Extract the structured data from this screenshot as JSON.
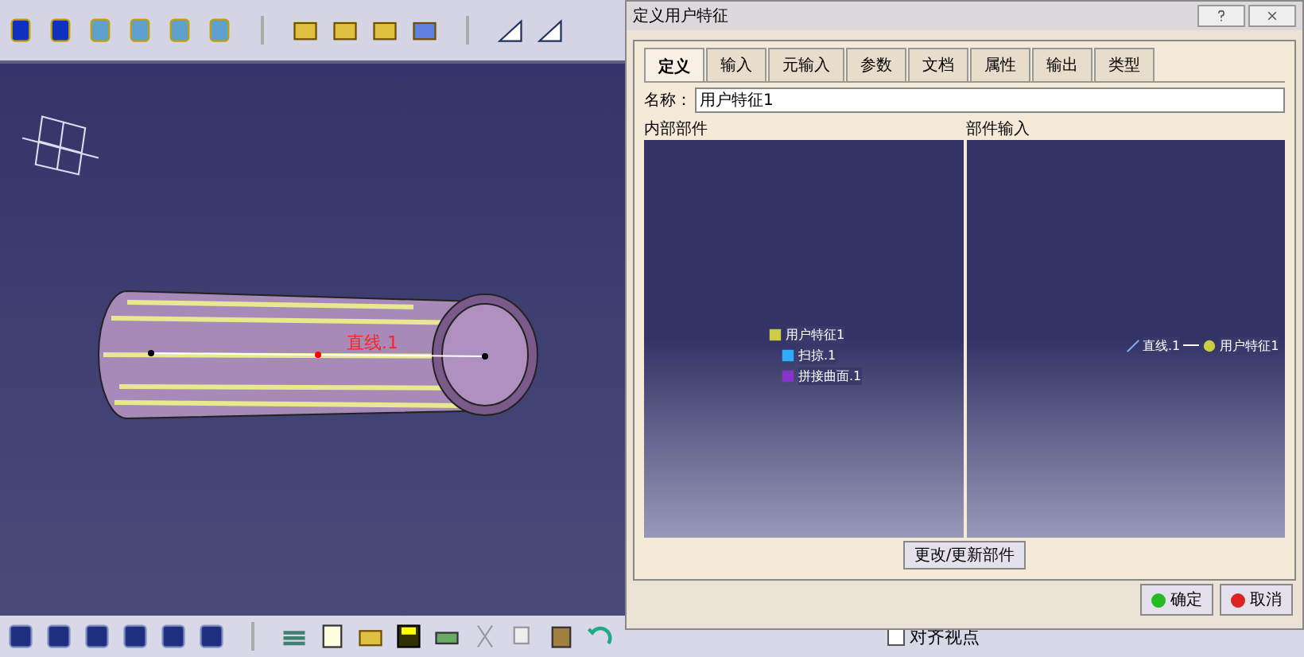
{
  "viewport": {
    "curve_label": "直线.1"
  },
  "dialog": {
    "title": "定义用户特征",
    "tabs": [
      {
        "label": "定义",
        "selected": true
      },
      {
        "label": "输入",
        "selected": false
      },
      {
        "label": "元输入",
        "selected": false
      },
      {
        "label": "参数",
        "selected": false
      },
      {
        "label": "文档",
        "selected": false
      },
      {
        "label": "属性",
        "selected": false
      },
      {
        "label": "输出",
        "selected": false
      },
      {
        "label": "类型",
        "selected": false
      }
    ],
    "name_label": "名称：",
    "name_value": "用户特征1",
    "internal_label": "内部部件",
    "inputs_label": "部件输入",
    "tree": [
      {
        "label": "用户特征1",
        "children": [
          {
            "label": "扫掠.1"
          },
          {
            "label": "拼接曲面.1"
          }
        ]
      }
    ],
    "inputs": [
      {
        "label": "直线.1",
        "target": "用户特征1"
      }
    ],
    "update_button": "更改/更新部件",
    "ok_button": "确定",
    "cancel_button": "取消"
  },
  "bottom_toolbar": {
    "checkbox_label": "对齐视点",
    "checked": false
  }
}
